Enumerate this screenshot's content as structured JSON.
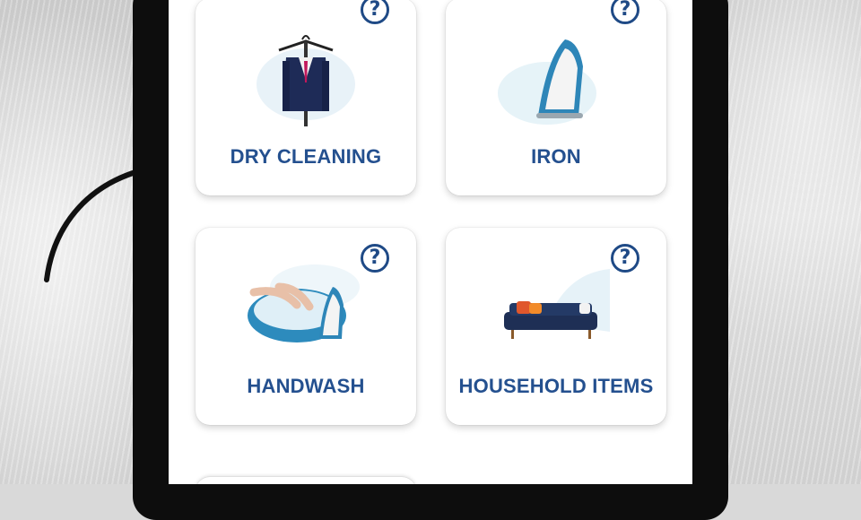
{
  "services": [
    {
      "label": "DRY CLEANING",
      "icon": "suit-on-hanger-image",
      "help": "?"
    },
    {
      "label": "IRON",
      "icon": "steam-iron-image",
      "help": "?"
    },
    {
      "label": "HANDWASH",
      "icon": "handwash-basin-image",
      "help": "?"
    },
    {
      "label": "HOUSEHOLD ITEMS",
      "icon": "sofa-image",
      "help": "?"
    }
  ],
  "colors": {
    "accent": "#24508f",
    "help_icon": "#1f4a86",
    "card_bg": "#ffffff",
    "frame": "#0d0d0d"
  }
}
